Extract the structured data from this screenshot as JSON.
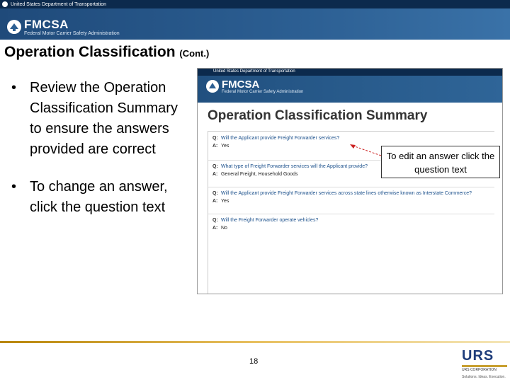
{
  "header": {
    "top_text": "United States Department of Transportation",
    "agency": "FMCSA",
    "agency_full": "Federal Motor Carrier Safety Administration"
  },
  "slide": {
    "title": "Operation Classification",
    "title_suffix": "(Cont.)",
    "bullets": [
      "Review the Operation Classification Summary to ensure the answers provided are correct",
      "To change an answer, click the question text"
    ]
  },
  "screenshot": {
    "top_text": "United States Department of Transportation",
    "agency": "FMCSA",
    "agency_full": "Federal Motor Carrier Safety Administration",
    "heading": "Operation Classification Summary",
    "q_label": "Q:",
    "a_label": "A:",
    "items": [
      {
        "q": "Will the Applicant provide Freight Forwarder services?",
        "a": "Yes"
      },
      {
        "q": "What type of Freight Forwarder services will the Applicant provide?",
        "a": "General Freight, Household Goods"
      },
      {
        "q": "Will the Applicant provide Freight Forwarder services across state lines otherwise known as Interstate Commerce?",
        "a": "Yes"
      },
      {
        "q": "Will the Freight Forwarder operate vehicles?",
        "a": "No"
      }
    ]
  },
  "callout": "To edit an answer click the question text",
  "footer": {
    "page_number": "18",
    "logo": "URS",
    "logo_sub": "URS CORPORATION",
    "tagline": "Solutions. Ideas. Execution."
  },
  "colors": {
    "banner": "#2c5f93",
    "topbar": "#0c2a4d",
    "question_link": "#1a4f8b",
    "footer_gold": "#c8a030",
    "urs_blue": "#1e3d7b"
  }
}
